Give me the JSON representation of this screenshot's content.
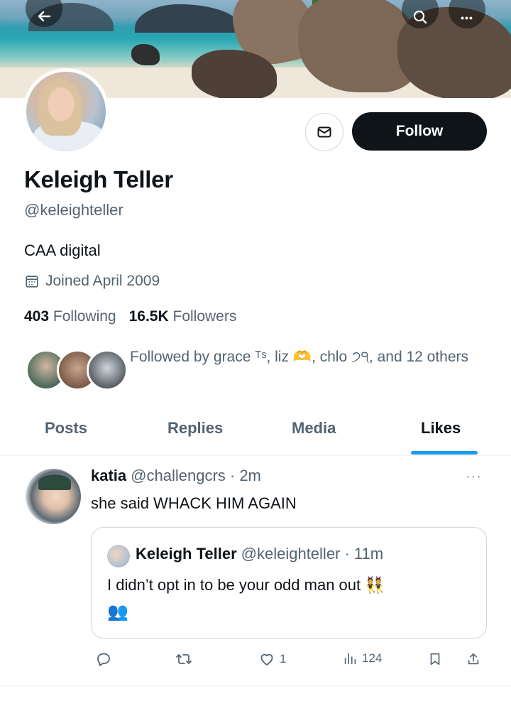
{
  "profile": {
    "name": "Keleigh Teller",
    "handle": "@keleighteller",
    "bio": "CAA digital",
    "joined": "Joined April 2009",
    "following_count": "403",
    "following_label": "Following",
    "followers_count": "16.5K",
    "followers_label": "Followers",
    "followed_by": "Followed by grace ᵀˢ, liz 🫶, chlo ੭੧, and 12 others"
  },
  "actions": {
    "follow_label": "Follow",
    "message_icon": "mail-icon"
  },
  "topbar": {
    "back_icon": "back-arrow-icon",
    "search_icon": "search-icon",
    "more_icon": "more-icon",
    "more_glyph": "•••"
  },
  "tabs": [
    {
      "label": "Posts"
    },
    {
      "label": "Replies"
    },
    {
      "label": "Media"
    },
    {
      "label": "Likes",
      "active": true
    }
  ],
  "tweet": {
    "name": "katia",
    "meta": "@challengcrs · 2m",
    "text": "she said WHACK HIM AGAIN",
    "more": "···",
    "quote": {
      "name": "Keleigh Teller",
      "meta": "@keleighteller · 11m",
      "text": "I didn’t opt in to be your odd man out 👯",
      "emoji": "👥"
    },
    "likes": "1",
    "views": "124"
  },
  "colors": {
    "accent": "#1d9bf0",
    "text": "#0f1419",
    "muted": "#536471"
  }
}
